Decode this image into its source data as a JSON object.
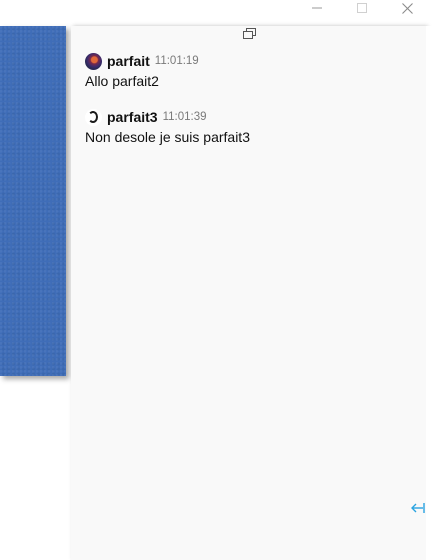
{
  "window": {
    "controls": {
      "minimize_icon": "minimize-icon",
      "maximize_icon": "maximize-icon",
      "close_icon": "close-icon"
    }
  },
  "chat": {
    "popout_icon": "popout-window-icon",
    "collapse_icon": "collapse-panel-icon",
    "accent_color": "#29a3e0",
    "messages": [
      {
        "author": "parfait",
        "time": "11:01:19",
        "text": "Allo parfait2"
      },
      {
        "author": "parfait3",
        "time": "11:01:39",
        "text": "Non desole je suis parfait3"
      }
    ]
  }
}
